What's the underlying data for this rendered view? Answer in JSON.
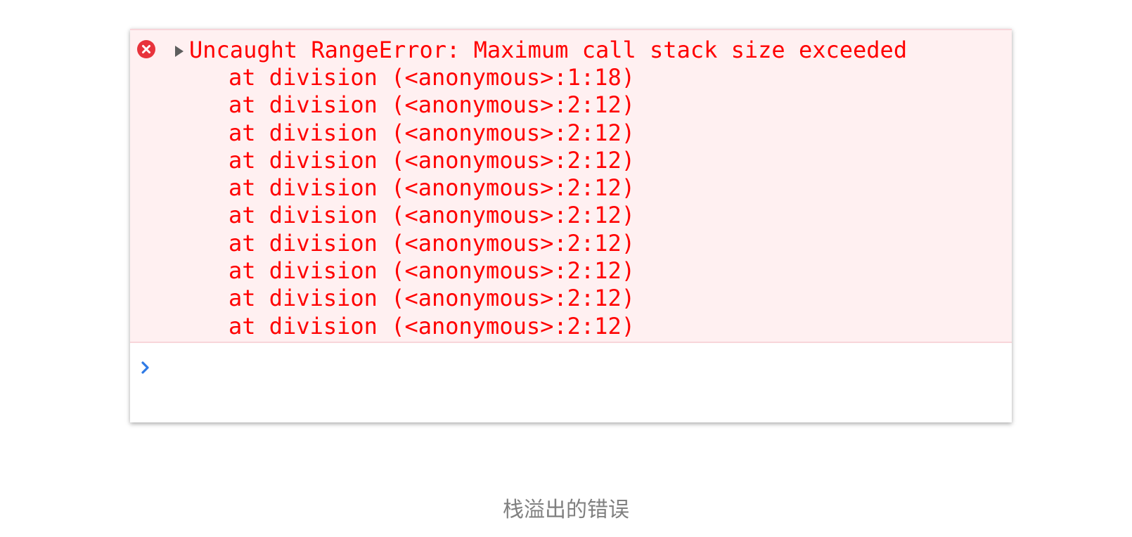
{
  "console": {
    "error": {
      "icon": "error-circle-x-icon",
      "expand_icon": "disclosure-triangle-icon",
      "message": "Uncaught RangeError: Maximum call stack size exceeded",
      "stack": [
        "at division (<anonymous>:1:18)",
        "at division (<anonymous>:2:12)",
        "at division (<anonymous>:2:12)",
        "at division (<anonymous>:2:12)",
        "at division (<anonymous>:2:12)",
        "at division (<anonymous>:2:12)",
        "at division (<anonymous>:2:12)",
        "at division (<anonymous>:2:12)",
        "at division (<anonymous>:2:12)",
        "at division (<anonymous>:2:12)"
      ]
    },
    "prompt_icon": "prompt-chevron-icon"
  },
  "caption": "栈溢出的错误",
  "colors": {
    "error_text": "#ff0000",
    "error_background": "#fff0f1",
    "error_icon": "#e8333c",
    "prompt": "#2f7ae5",
    "caption": "#808080"
  }
}
